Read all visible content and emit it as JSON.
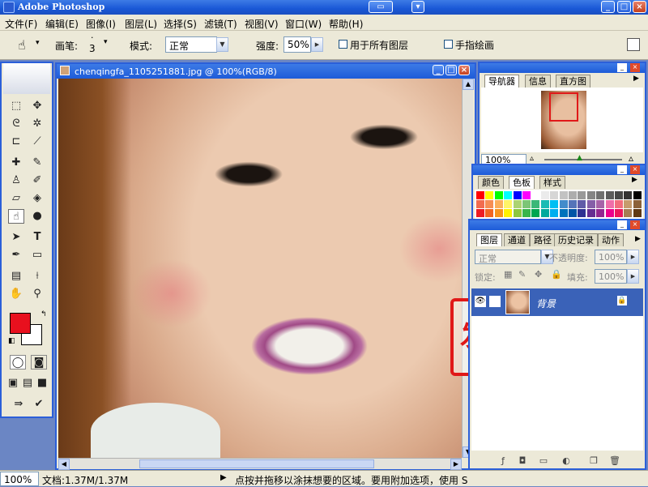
{
  "app": {
    "title": "Adobe Photoshop"
  },
  "menu": [
    "文件(F)",
    "编辑(E)",
    "图像(I)",
    "图层(L)",
    "选择(S)",
    "滤镜(T)",
    "视图(V)",
    "窗口(W)",
    "帮助(H)"
  ],
  "options": {
    "brush_label": "画笔:",
    "brush_size": "3",
    "mode_label": "模式:",
    "mode_value": "正常",
    "strength_label": "强度:",
    "strength_value": "50%",
    "all_layers_label": "用于所有图层",
    "finger_paint_label": "手指绘画"
  },
  "document": {
    "title": "chenqingfa_1105251881.jpg @ 100%(RGB/8)"
  },
  "navigator": {
    "tabs": [
      "导航器",
      "信息",
      "直方图"
    ],
    "zoom": "100%"
  },
  "color_panel": {
    "tabs": [
      "颜色",
      "色板",
      "样式"
    ]
  },
  "layers_panel": {
    "tabs": [
      "图层",
      "通道",
      "路径",
      "历史记录",
      "动作"
    ],
    "blend_mode": "正常",
    "opacity_label": "不透明度:",
    "opacity_value": "100%",
    "lock_label": "锁定:",
    "fill_label": "填充:",
    "fill_value": "100%",
    "layer_name": "背景"
  },
  "status": {
    "zoom": "100%",
    "doc_info": "文档:1.37M/1.37M",
    "hint": "点按并拖移以涂抹想要的区域。要用附加选项，使用 S"
  },
  "colors": {
    "foreground": "#e8101e",
    "background": "#ffffff",
    "accent": "#2b5fd9"
  },
  "stamp_text": "陈庆发"
}
